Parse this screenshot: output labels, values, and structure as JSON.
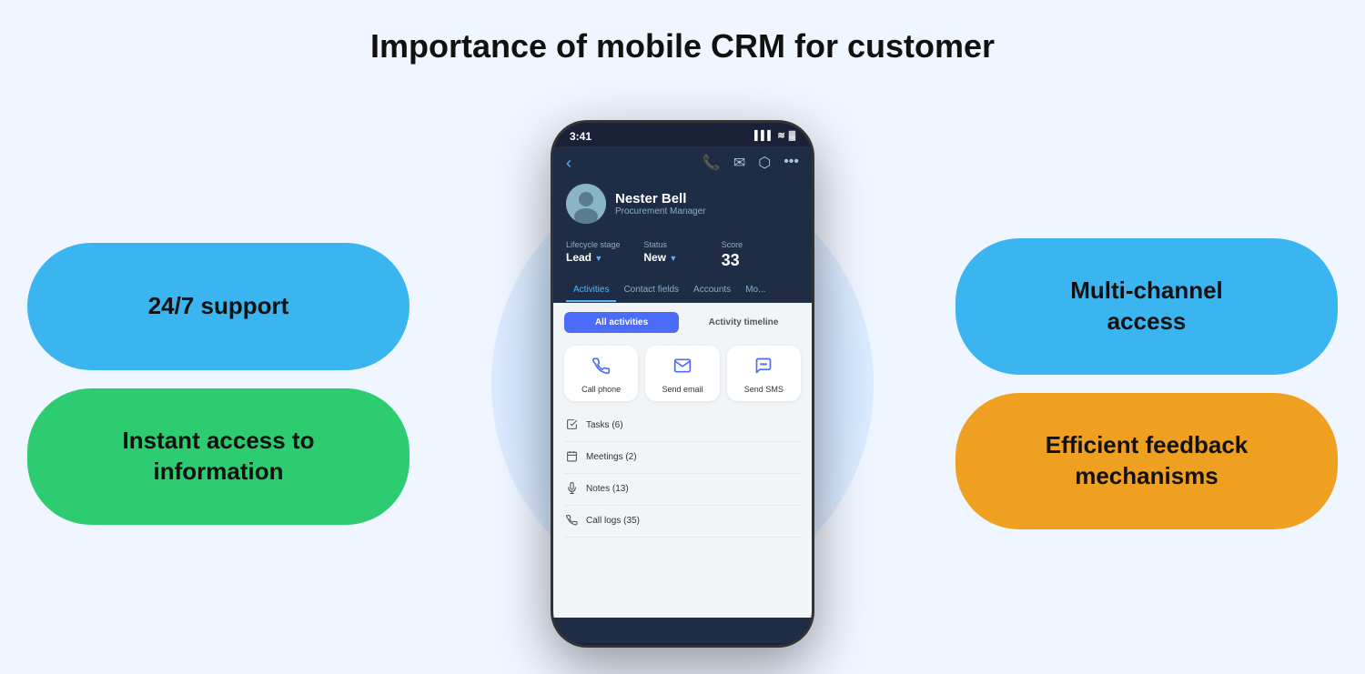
{
  "page": {
    "title": "Importance of mobile CRM for customer",
    "background": "#f0f6ff"
  },
  "left_blobs": [
    {
      "id": "support",
      "text": "24/7 support",
      "color": "#3bb5f0"
    },
    {
      "id": "access",
      "text": "Instant access to\ninformation",
      "color": "#2ecc71"
    }
  ],
  "right_blobs": [
    {
      "id": "multichannel",
      "text": "Multi-channel\naccess",
      "color": "#3bb5f0"
    },
    {
      "id": "feedback",
      "text": "Efficient feedback\nmechanisms",
      "color": "#f0a020"
    }
  ],
  "phone": {
    "status_time": "3:41",
    "status_signal": "▌▌▌",
    "status_wifi": "⊕",
    "status_battery": "▓",
    "contact_name": "Nester Bell",
    "contact_role": "Procurement Manager",
    "lifecycle_label": "Lifecycle stage",
    "lifecycle_value": "Lead",
    "status_label": "Status",
    "status_value": "New",
    "score_label": "Score",
    "score_value": "33",
    "tabs": [
      "Activities",
      "Contact fields",
      "Accounts",
      "Mo..."
    ],
    "toggle_all": "All activities",
    "toggle_timeline": "Activity timeline",
    "actions": [
      {
        "id": "call",
        "icon": "📞",
        "label": "Call phone"
      },
      {
        "id": "email",
        "icon": "✉",
        "label": "Send email"
      },
      {
        "id": "sms",
        "icon": "💬",
        "label": "Send SMS"
      }
    ],
    "activity_items": [
      {
        "icon": "☑",
        "text": "Tasks (6)"
      },
      {
        "icon": "📅",
        "text": "Meetings (2)"
      },
      {
        "icon": "🎙",
        "text": "Notes (13)"
      },
      {
        "icon": "📞",
        "text": "Call logs (35)"
      }
    ]
  }
}
